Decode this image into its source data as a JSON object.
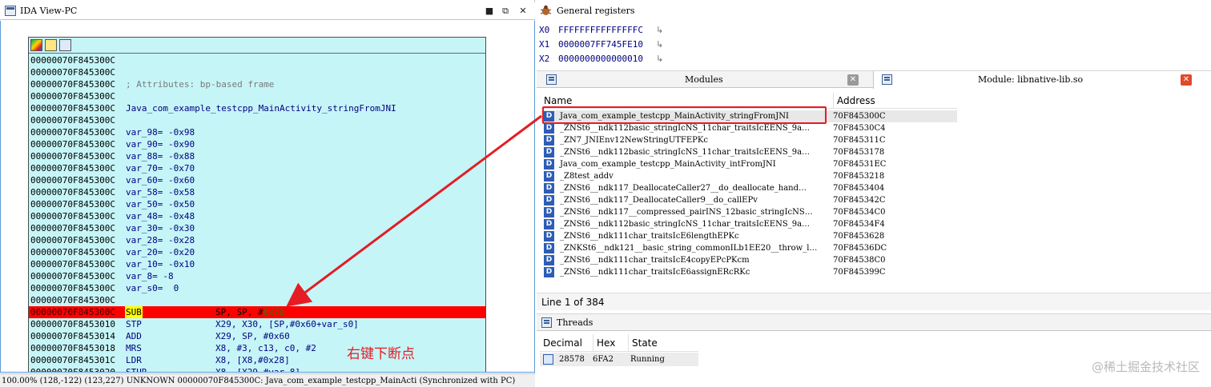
{
  "ida_view": {
    "title": "IDA View-PC",
    "window_buttons": [
      "■",
      "⧉",
      "✕"
    ],
    "asm_lines": [
      {
        "addr": "00000070F845300C",
        "text": ""
      },
      {
        "addr": "00000070F845300C",
        "text": ""
      },
      {
        "addr": "00000070F845300C",
        "text": "; Attributes: bp-based frame",
        "comment": true
      },
      {
        "addr": "00000070F845300C",
        "text": ""
      },
      {
        "addr": "00000070F845300C",
        "text": "Java_com_example_testcpp_MainActivity_stringFromJNI"
      },
      {
        "addr": "00000070F845300C",
        "text": ""
      },
      {
        "addr": "00000070F845300C",
        "text": "var_98= -0x98"
      },
      {
        "addr": "00000070F845300C",
        "text": "var_90= -0x90"
      },
      {
        "addr": "00000070F845300C",
        "text": "var_88= -0x88"
      },
      {
        "addr": "00000070F845300C",
        "text": "var_70= -0x70"
      },
      {
        "addr": "00000070F845300C",
        "text": "var_60= -0x60"
      },
      {
        "addr": "00000070F845300C",
        "text": "var_58= -0x58"
      },
      {
        "addr": "00000070F845300C",
        "text": "var_50= -0x50"
      },
      {
        "addr": "00000070F845300C",
        "text": "var_48= -0x48"
      },
      {
        "addr": "00000070F845300C",
        "text": "var_30= -0x30"
      },
      {
        "addr": "00000070F845300C",
        "text": "var_28= -0x28"
      },
      {
        "addr": "00000070F845300C",
        "text": "var_20= -0x20"
      },
      {
        "addr": "00000070F845300C",
        "text": "var_10= -0x10"
      },
      {
        "addr": "00000070F845300C",
        "text": "var_8= -8"
      },
      {
        "addr": "00000070F845300C",
        "text": "var_s0=  0"
      },
      {
        "addr": "00000070F845300C",
        "text": ""
      }
    ],
    "instructions": [
      {
        "addr": "00000070F845300C",
        "mnem": "SUB",
        "ops_pre": "SP, SP, #",
        "imm": "0x70",
        "ops_post": "",
        "highlighted": true
      },
      {
        "addr": "00000070F8453010",
        "mnem": "STP",
        "ops_pre": "X29, X30, [SP,#0x60+var_s0]",
        "imm": "",
        "ops_post": ""
      },
      {
        "addr": "00000070F8453014",
        "mnem": "ADD",
        "ops_pre": "X29, SP, #0x60",
        "imm": "",
        "ops_post": ""
      },
      {
        "addr": "00000070F8453018",
        "mnem": "MRS",
        "ops_pre": "X8, #3, c13, c0, #2",
        "imm": "",
        "ops_post": ""
      },
      {
        "addr": "00000070F845301C",
        "mnem": "LDR",
        "ops_pre": "X8, [X8,#0x28]",
        "imm": "",
        "ops_post": ""
      },
      {
        "addr": "00000070F8453020",
        "mnem": "STUR",
        "ops_pre": "X8, [X29,#var_8]",
        "imm": "",
        "ops_post": ""
      }
    ],
    "status_bar": "100.00% (128,-122) (123,227) UNKNOWN 00000070F845300C: Java_com_example_testcpp_MainActi (Synchronized with PC)"
  },
  "annotation": {
    "text": "右键下断点",
    "color": "#e51c23"
  },
  "general_registers": {
    "title": "General registers",
    "rows": [
      {
        "name": "X0",
        "value": "FFFFFFFFFFFFFFFC",
        "jump": "↳"
      },
      {
        "name": "X1",
        "value": "0000007FF745FE10",
        "jump": "↳"
      },
      {
        "name": "X2",
        "value": "0000000000000010",
        "jump": "↳"
      }
    ]
  },
  "tabs": [
    {
      "label": "Modules",
      "close": "✕",
      "active": false
    },
    {
      "label": "Module: libnative-lib.so",
      "close": "✕",
      "active": true
    }
  ],
  "modules": {
    "columns": {
      "name": "Name",
      "address": "Address"
    },
    "type_badge": "D",
    "rows": [
      {
        "name": "Java_com_example_testcpp_MainActivity_stringFromJNI",
        "address": "70F845300C",
        "selected": true
      },
      {
        "name": "_ZNSt6__ndk112basic_stringIcNS_11char_traitsIcEENS_9a…",
        "address": "70F84530C4"
      },
      {
        "name": "_ZN7_JNIEnv12NewStringUTFEPKc",
        "address": "70F845311C"
      },
      {
        "name": "_ZNSt6__ndk112basic_stringIcNS_11char_traitsIcEENS_9a…",
        "address": "70F8453178"
      },
      {
        "name": "Java_com_example_testcpp_MainActivity_intFromJNI",
        "address": "70F84531EC"
      },
      {
        "name": "_Z8test_addv",
        "address": "70F8453218"
      },
      {
        "name": "_ZNSt6__ndk117_DeallocateCaller27__do_deallocate_hand…",
        "address": "70F8453404"
      },
      {
        "name": "_ZNSt6__ndk117_DeallocateCaller9__do_callEPv",
        "address": "70F845342C"
      },
      {
        "name": "_ZNSt6__ndk117__compressed_pairINS_12basic_stringIcNS…",
        "address": "70F84534C0"
      },
      {
        "name": "_ZNSt6__ndk112basic_stringIcNS_11char_traitsIcEENS_9a…",
        "address": "70F84534F4"
      },
      {
        "name": "_ZNSt6__ndk111char_traitsIcE6lengthEPKc",
        "address": "70F8453628"
      },
      {
        "name": "_ZNKSt6__ndk121__basic_string_commonILb1EE20__throw_l…",
        "address": "70F84536DC"
      },
      {
        "name": "_ZNSt6__ndk111char_traitsIcE4copyEPcPKcm",
        "address": "70F84538C0"
      },
      {
        "name": "_ZNSt6__ndk111char_traitsIcE6assignERcRKc",
        "address": "70F845399C"
      }
    ],
    "line_status": "Line 1 of 384"
  },
  "threads": {
    "title": "Threads",
    "columns": {
      "decimal": "Decimal",
      "hex": "Hex",
      "state": "State"
    },
    "rows": [
      {
        "decimal": "28578",
        "hex": "6FA2",
        "state": "Running"
      }
    ]
  },
  "watermark": "@稀土掘金技术社区",
  "colors": {
    "node_bg": "#c5f5f7",
    "highlight_red": "#ff0000",
    "asm_blue": "#000080",
    "badge_blue": "#2d5db5"
  }
}
